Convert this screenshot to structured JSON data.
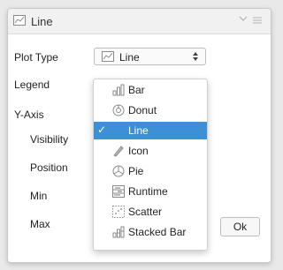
{
  "dialog": {
    "title": "Line",
    "title_icon": "line-chart-icon",
    "ok_label": "Ok"
  },
  "labels": {
    "plot_type": "Plot Type",
    "legend": "Legend",
    "y_axis": "Y-Axis",
    "visibility": "Visibility",
    "position": "Position",
    "min": "Min",
    "max": "Max"
  },
  "plot_type_select": {
    "value": "Line",
    "icon": "line-chart-icon"
  },
  "plot_type_menu": {
    "selected": "Line",
    "items": [
      {
        "label": "Bar",
        "icon": "bar-chart-icon"
      },
      {
        "label": "Donut",
        "icon": "donut-chart-icon"
      },
      {
        "label": "Line",
        "icon": "line-chart-icon"
      },
      {
        "label": "Icon",
        "icon": "icon-chart-icon"
      },
      {
        "label": "Pie",
        "icon": "pie-chart-icon"
      },
      {
        "label": "Runtime",
        "icon": "runtime-chart-icon"
      },
      {
        "label": "Scatter",
        "icon": "scatter-chart-icon"
      },
      {
        "label": "Stacked Bar",
        "icon": "stacked-bar-chart-icon"
      }
    ]
  },
  "colors": {
    "selection": "#3d8fd6",
    "header_bg": "#f1f1f1"
  }
}
